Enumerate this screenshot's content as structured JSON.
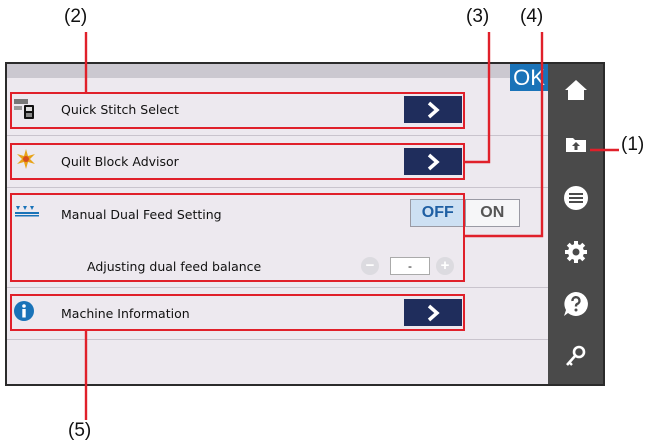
{
  "callouts": {
    "c1": "(1)",
    "c2": "(2)",
    "c3": "(3)",
    "c4": "(4)",
    "c5": "(5)"
  },
  "ok_label": "OK",
  "menu": {
    "quick_stitch": {
      "label": "Quick Stitch Select",
      "icon": "quick-stitch-icon"
    },
    "quilt_block": {
      "label": "Quilt Block Advisor",
      "icon": "quilt-block-icon"
    },
    "dual_feed": {
      "label": "Manual Dual Feed Setting",
      "icon": "dual-feed-icon",
      "off_label": "OFF",
      "on_label": "ON",
      "selected": "OFF",
      "balance_label": "Adjusting dual feed balance",
      "balance_value": "-",
      "minus_label": "−",
      "plus_label": "+"
    },
    "machine_info": {
      "label": "Machine Information",
      "icon": "info-icon"
    }
  },
  "sidebar_icons": [
    "home-icon",
    "folder-upload-icon",
    "menu-icon",
    "gear-icon",
    "help-icon",
    "key-icon"
  ],
  "colors": {
    "accent_blue": "#1a73b8",
    "arrow_button": "#1f2d5c",
    "sidebar": "#4a4a4a",
    "panel": "#ede9ef",
    "highlight_red": "#e0202a"
  }
}
